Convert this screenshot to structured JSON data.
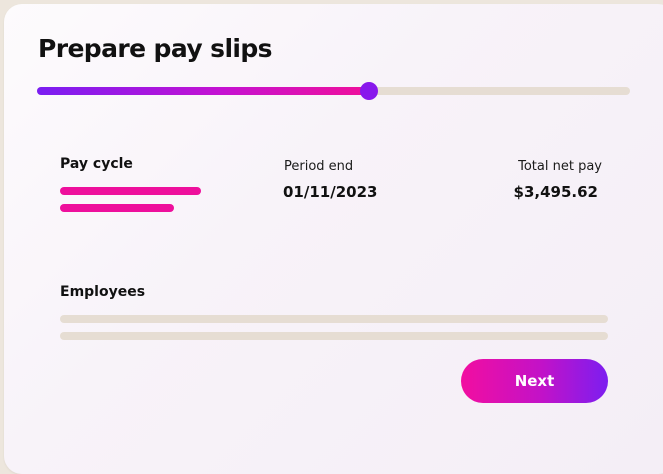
{
  "header": {
    "title": "Prepare pay slips"
  },
  "progress": {
    "fraction": 0.56
  },
  "summary": {
    "pay_cycle_label": "Pay cycle",
    "period_end_label": "Period end",
    "period_end_value": "01/11/2023",
    "total_net_pay_label": "Total net pay",
    "total_net_pay_value": "$3,495.62"
  },
  "employees": {
    "label": "Employees"
  },
  "actions": {
    "next_label": "Next"
  },
  "colors": {
    "accent_pink": "#ee0f9c",
    "accent_purple": "#7a1ef2",
    "placeholder": "#e6ddd3",
    "text": "#111111"
  }
}
